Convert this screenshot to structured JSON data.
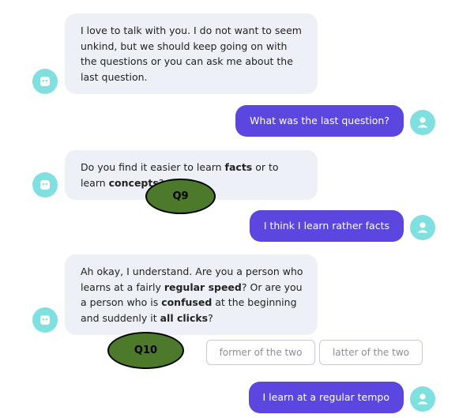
{
  "messages": [
    {
      "id": "m1",
      "sender": "bot",
      "segments": [
        {
          "text": "I love to talk with you. I do not want to seem unkind, but we should keep going on with the questions or you can ask me about the last question.",
          "bold": false
        }
      ]
    },
    {
      "id": "m2",
      "sender": "user",
      "text": "What was the last question?"
    },
    {
      "id": "m3",
      "sender": "bot",
      "segments": [
        {
          "text": "Do you find it easier to learn ",
          "bold": false
        },
        {
          "text": "facts",
          "bold": true
        },
        {
          "text": " or to learn ",
          "bold": false
        },
        {
          "text": "concepts",
          "bold": true
        },
        {
          "text": "?",
          "bold": false
        }
      ]
    },
    {
      "id": "m4",
      "sender": "user",
      "text": "I think I learn rather facts"
    },
    {
      "id": "m5",
      "sender": "bot",
      "segments": [
        {
          "text": "Ah okay, I understand. Are you a person who learns at a fairly ",
          "bold": false
        },
        {
          "text": "regular speed",
          "bold": true
        },
        {
          "text": "? Or are you a person who is ",
          "bold": false
        },
        {
          "text": "confused",
          "bold": true
        },
        {
          "text": " at the beginning and suddenly it ",
          "bold": false
        },
        {
          "text": "all clicks",
          "bold": true
        },
        {
          "text": "?",
          "bold": false
        }
      ]
    },
    {
      "id": "m6",
      "sender": "user",
      "text": "I learn at a regular tempo"
    }
  ],
  "quick_replies": [
    "former of the two",
    "latter of the two"
  ],
  "annotations": {
    "q9": "Q9",
    "q10": "Q10"
  },
  "colors": {
    "bot_bubble": "#eef0f7",
    "user_bubble": "#5b47e0",
    "avatar": "#7fe0df",
    "annotation_fill": "#4c7a2a"
  },
  "icons": {
    "bot_avatar": "bot-face-icon",
    "user_avatar": "user-person-icon"
  }
}
